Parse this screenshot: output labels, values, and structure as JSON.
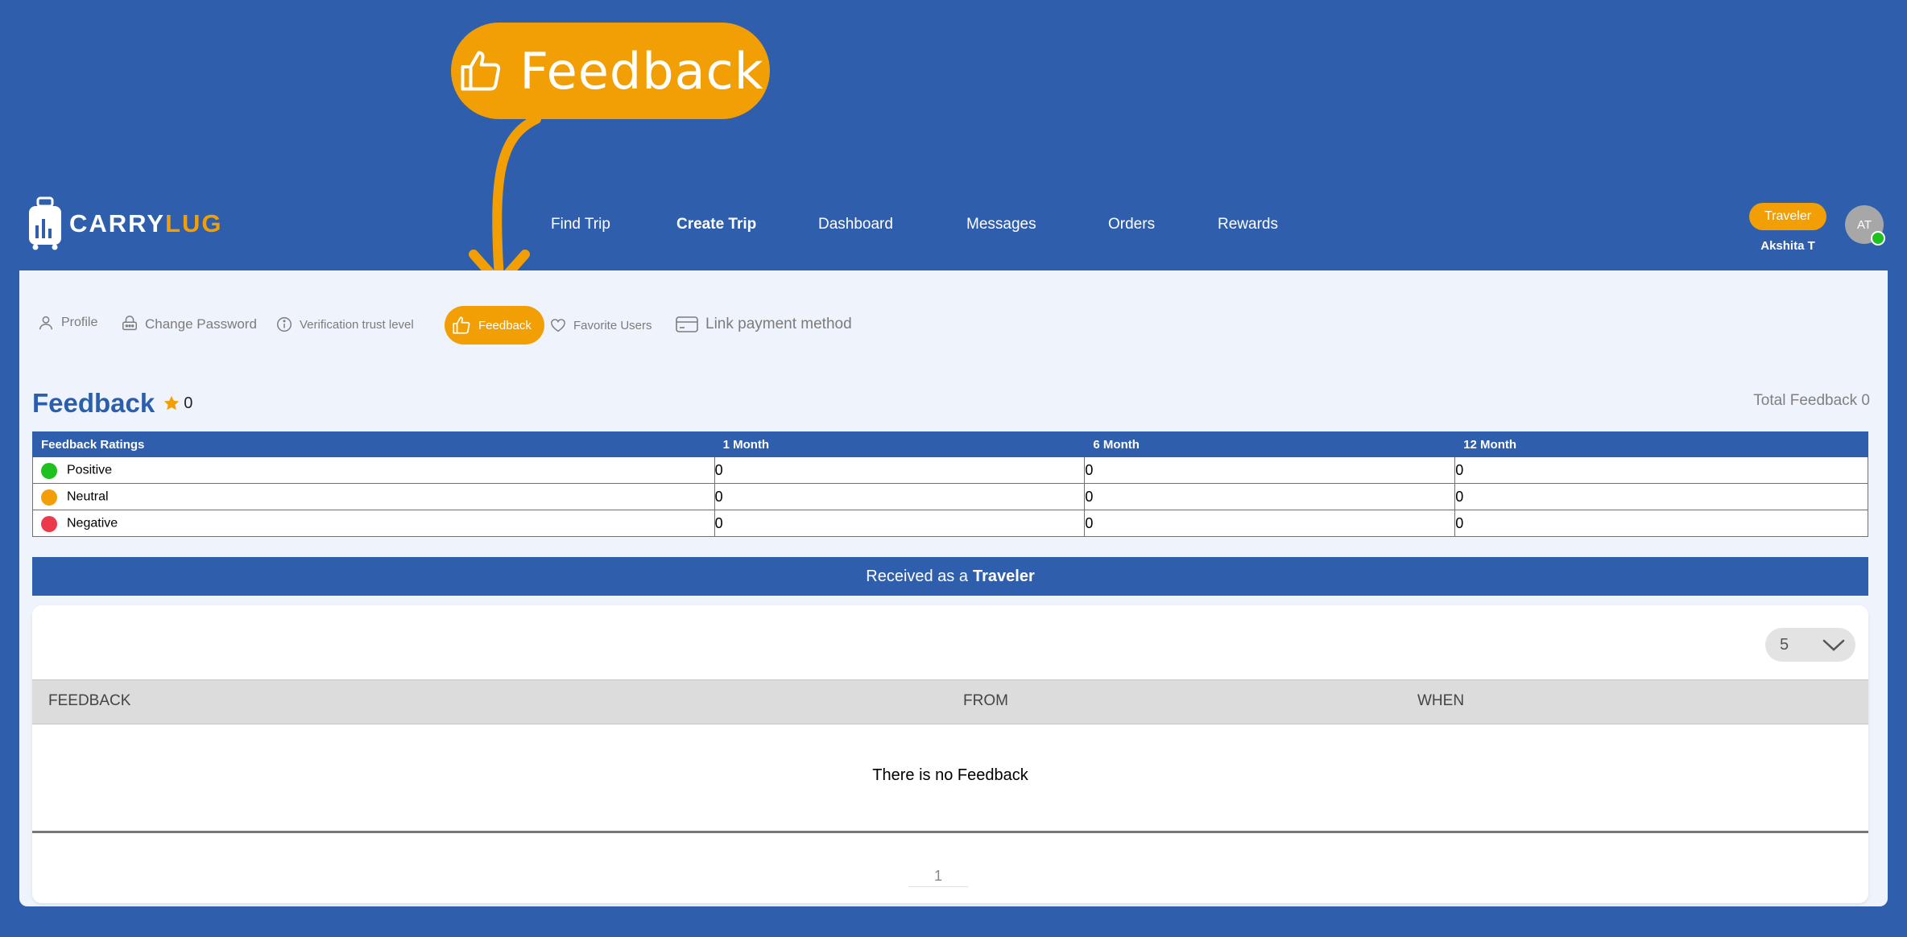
{
  "callout": {
    "label": "Feedback",
    "icon": "thumbs-up-icon"
  },
  "brand": {
    "part1": "CARRY",
    "part2": "LUG"
  },
  "nav": {
    "items": [
      "Find Trip",
      "Create Trip",
      "Dashboard",
      "Messages",
      "Orders",
      "Rewards"
    ],
    "active": "Create Trip"
  },
  "user": {
    "role": "Traveler",
    "name": "Akshita T",
    "initials": "AT"
  },
  "subnav": [
    {
      "label": "Profile",
      "icon": "person-icon"
    },
    {
      "label": "Change Password",
      "icon": "lock-icon"
    },
    {
      "label": "Verification trust level",
      "icon": "info-icon"
    },
    {
      "label": "Feedback",
      "icon": "thumbs-up-icon",
      "active": true
    },
    {
      "label": "Favorite Users",
      "icon": "heart-icon"
    },
    {
      "label": "Link payment method",
      "icon": "card-icon"
    }
  ],
  "page": {
    "title": "Feedback",
    "rating": "0",
    "total_feedback": "Total Feedback 0"
  },
  "ratings": {
    "headers": [
      "Feedback Ratings",
      "1 Month",
      "6 Month",
      "12 Month"
    ],
    "rows": [
      {
        "label": "Positive",
        "color": "#1fc11f",
        "values": [
          "0",
          "0",
          "0"
        ]
      },
      {
        "label": "Neutral",
        "color": "#f29f05",
        "values": [
          "0",
          "0",
          "0"
        ]
      },
      {
        "label": "Negative",
        "color": "#ea3a4c",
        "values": [
          "0",
          "0",
          "0"
        ]
      }
    ]
  },
  "received": {
    "prefix": "Received as a",
    "role": "Traveler"
  },
  "list": {
    "page_size": "5",
    "columns": [
      "FEEDBACK",
      "FROM",
      "WHEN"
    ],
    "empty_message": "There is no Feedback",
    "current_page": "1"
  },
  "colors": {
    "primary": "#2f5fac",
    "accent": "#f29f05",
    "panel": "#eef3fc"
  }
}
